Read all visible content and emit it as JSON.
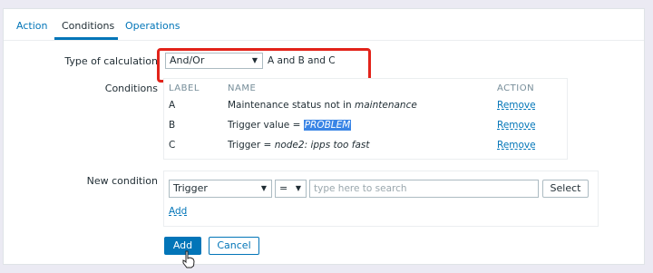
{
  "tabs": [
    "Action",
    "Conditions",
    "Operations"
  ],
  "type_of_calculation": {
    "label": "Type of calculation",
    "value": "And/Or",
    "expression": "A and B and C"
  },
  "conditions": {
    "label": "Conditions",
    "headers": {
      "label": "LABEL",
      "name": "NAME",
      "action": "ACTION"
    },
    "rows": [
      {
        "label": "A",
        "name_prefix": "Maintenance status not in ",
        "name_value": "maintenance",
        "action": "Remove"
      },
      {
        "label": "B",
        "name_prefix": "Trigger value = ",
        "name_value": "PROBLEM",
        "action": "Remove"
      },
      {
        "label": "C",
        "name_prefix": "Trigger = ",
        "name_value": "node2: ipps too fast",
        "action": "Remove"
      }
    ]
  },
  "new_condition": {
    "label": "New condition",
    "type_value": "Trigger",
    "operator_value": "=",
    "search_placeholder": "type here to search",
    "select_label": "Select",
    "add_link": "Add"
  },
  "buttons": {
    "add": "Add",
    "cancel": "Cancel"
  },
  "colors": {
    "accent": "#0275b8",
    "highlight": "#e2231a",
    "selection": "#3a85e6"
  }
}
